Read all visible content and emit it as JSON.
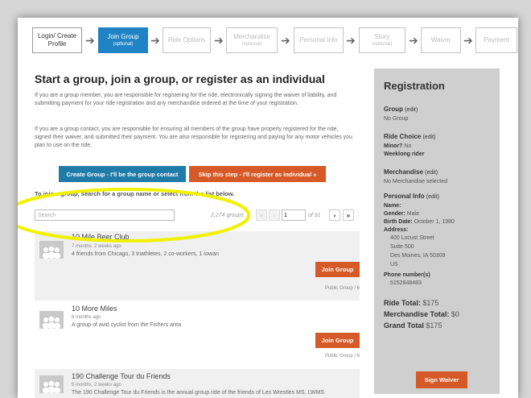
{
  "steps": [
    {
      "label": "Login/ Create",
      "label2": "Profile",
      "sub": ""
    },
    {
      "label": "Join Group",
      "label2": "",
      "sub": "(optional)"
    },
    {
      "label": "Ride Options",
      "label2": "",
      "sub": ""
    },
    {
      "label": "Merchandise",
      "label2": "",
      "sub": "(optional)"
    },
    {
      "label": "Personal Info",
      "label2": "",
      "sub": ""
    },
    {
      "label": "Story",
      "label2": "",
      "sub": "(optional)"
    },
    {
      "label": "Waiver",
      "label2": "",
      "sub": ""
    },
    {
      "label": "Payment",
      "label2": "",
      "sub": ""
    }
  ],
  "main": {
    "title": "Start a group, join a group, or register as an individual",
    "para1": "If you are a group member, you are responsible for registering for the ride, electronically signing the waiver of liability, and submitting payment for your ride registration and any merchandise ordered at the time of your registration.",
    "para2": "If you are a group contact, you are responsible for ensuring all members of the group have properly registered for the ride, signed their waiver, and submitted their payment. You are also responsible for registering and paying for any motor vehicles you plan to use on the ride.",
    "create_group": "Create Group - I'll be the group contact",
    "skip_step": "Skip this step - I'll register as individual »",
    "hint": "To join a group, search for a group name or select from the list below.",
    "search_placeholder": "Search",
    "count": "2,274 groups",
    "page_value": "1",
    "page_of": "of 91",
    "first": "«",
    "prev": "‹",
    "next": "›",
    "last": "»"
  },
  "groups": [
    {
      "name": "10 Mile Beer Club",
      "time": "7 months, 2 weeks ago",
      "desc": "4 friends from Chicago, 3 triathletes, 2 co-workers, 1 Iowan",
      "join": "Join Group",
      "meta": "Public Group / 6"
    },
    {
      "name": "10 More Miles",
      "time": "8 months ago",
      "desc": "A group of avid cyclist from the Fishers area",
      "join": "Join Group",
      "meta": "Public Group / 6"
    },
    {
      "name": "190 Challenge Tour du Friends",
      "time": "5 months, 2 weeks ago",
      "desc": "The 190 Challenge Tour du Friends is the annual group ride of the friends of Les Wrestles MS, LWMS",
      "join": "",
      "meta": ""
    }
  ],
  "sidebar": {
    "title": "Registration",
    "edit": "(edit)",
    "group_label": "Group",
    "group_value": "No Group",
    "ride_label": "Ride Choice",
    "minor_label": "Minor?",
    "minor_value": "No",
    "weeklong": "Weeklong rider",
    "merch_label": "Merchandise",
    "merch_value": "No Merchandise selected",
    "personal_label": "Personal Info",
    "name_label": "Name:",
    "gender_label": "Gender:",
    "gender_value": "Male",
    "birth_label": "Birth Date:",
    "birth_value": "October 1, 1980",
    "address_label": "Address:",
    "address": [
      "400 Locust Street",
      "Suite 500",
      "Des Moines, IA 50309",
      "US"
    ],
    "phone_label": "Phone number(s)",
    "phone_value": "5152848483",
    "ride_total_label": "Ride Total:",
    "ride_total": "$175",
    "merch_total_label": "Merchandise Total:",
    "merch_total": "$0",
    "grand_total_label": "Grand Total",
    "grand_total": "$175",
    "sign_waiver": "Sign Waiver"
  },
  "colors": {
    "active": "#1f83c6",
    "orange": "#d55a28",
    "blue": "#1f7ba8",
    "highlight": "#f2f200"
  }
}
